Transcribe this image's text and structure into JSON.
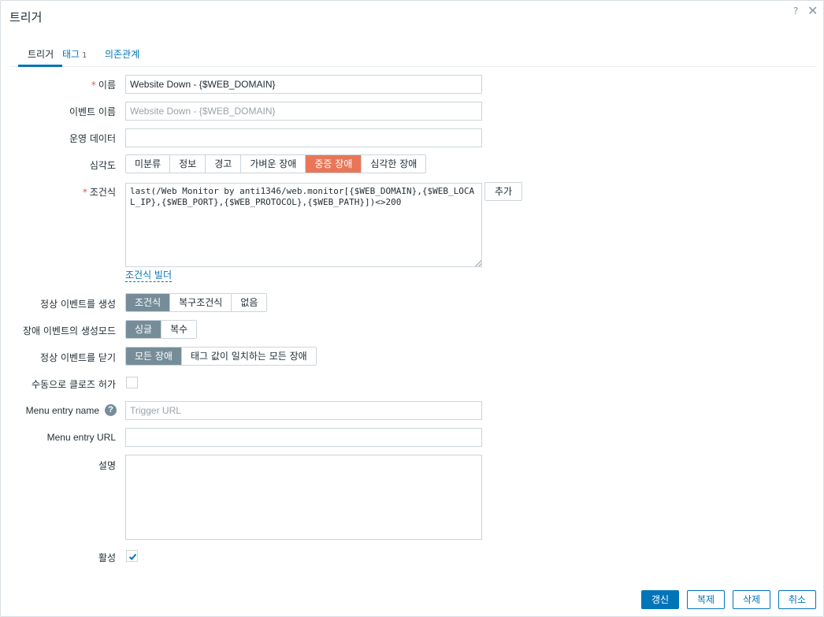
{
  "dialog": {
    "title": "트리거",
    "help_glyph": "?",
    "close_glyph": "✕"
  },
  "tabs": [
    {
      "label": "트리거",
      "count": ""
    },
    {
      "label": "태그",
      "count": "1"
    },
    {
      "label": "의존관계",
      "count": ""
    }
  ],
  "form": {
    "name": {
      "label": "이름",
      "value": "Website Down - {$WEB_DOMAIN}"
    },
    "event_name": {
      "label": "이벤트 이름",
      "placeholder": "Website Down - {$WEB_DOMAIN}"
    },
    "opdata": {
      "label": "운영 데이터",
      "value": ""
    },
    "severity": {
      "label": "심각도",
      "options": [
        "미분류",
        "정보",
        "경고",
        "가벼운 장애",
        "중증 장애",
        "심각한 장애"
      ],
      "selected": "중증 장애",
      "selected_color": "#e97659"
    },
    "expression": {
      "label": "조건식",
      "value": "last(/Web Monitor by anti1346/web.monitor[{$WEB_DOMAIN},{$WEB_LOCAL_IP},{$WEB_PORT},{$WEB_PROTOCOL},{$WEB_PATH}])<>200",
      "add_label": "추가",
      "builder_link": "조건식 빌더"
    },
    "recovery": {
      "label": "정상 이벤트를 생성",
      "options": [
        "조건식",
        "복구조건식",
        "없음"
      ],
      "selected": "조건식"
    },
    "event_mode": {
      "label": "장애 이벤트의 생성모드",
      "options": [
        "싱글",
        "복수"
      ],
      "selected": "싱글"
    },
    "ok_close": {
      "label": "정상 이벤트를 닫기",
      "options": [
        "모든 장애",
        "태그 값이 일치하는 모든 장애"
      ],
      "selected": "모든 장애"
    },
    "manual_close": {
      "label": "수동으로 클로즈 허가",
      "checked": false
    },
    "url_name": {
      "label": "Menu entry name",
      "placeholder": "Trigger URL",
      "help_glyph": "?"
    },
    "url": {
      "label": "Menu entry URL",
      "value": ""
    },
    "description": {
      "label": "설명",
      "value": ""
    },
    "enabled": {
      "label": "활성",
      "checked": true
    }
  },
  "footer": {
    "update": "갱신",
    "clone": "복제",
    "delete": "삭제",
    "cancel": "취소"
  },
  "colors": {
    "accent": "#0275b8",
    "selected_segment": "#768d99",
    "required_marker": "#e45959"
  }
}
